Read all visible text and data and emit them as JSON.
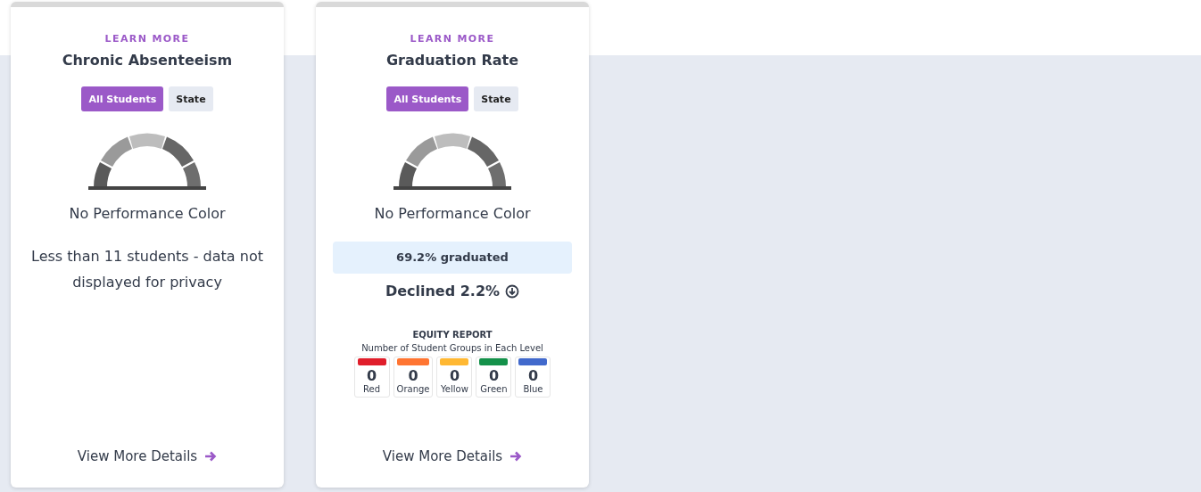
{
  "cards": [
    {
      "link": "LEARN MORE",
      "title": "Chronic Absenteeism",
      "toggles": [
        {
          "label": "All Students",
          "selected": true
        },
        {
          "label": "State",
          "selected": false
        }
      ],
      "status": "No Performance Color",
      "note": "Less than 11 students - data not displayed for privacy",
      "details": "View More Details"
    },
    {
      "link": "LEARN MORE",
      "title": "Graduation Rate",
      "toggles": [
        {
          "label": "All Students",
          "selected": true
        },
        {
          "label": "State",
          "selected": false
        }
      ],
      "status": "No Performance Color",
      "result": "69.2% graduated",
      "change": "Declined 2.2%",
      "equity": {
        "title": "EQUITY REPORT",
        "subtitle": "Number of Student Groups in Each Level",
        "levels": [
          {
            "count": "0",
            "label": "Red",
            "color": "#e01e2b"
          },
          {
            "count": "0",
            "label": "Orange",
            "color": "#ff7532"
          },
          {
            "count": "0",
            "label": "Yellow",
            "color": "#ffb833"
          },
          {
            "count": "0",
            "label": "Green",
            "color": "#14914a"
          },
          {
            "count": "0",
            "label": "Blue",
            "color": "#4169cc"
          }
        ]
      },
      "details": "View More Details"
    }
  ]
}
